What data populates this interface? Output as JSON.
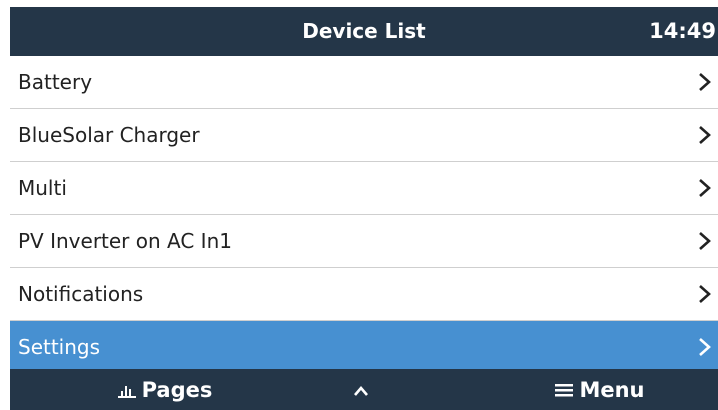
{
  "header": {
    "title": "Device List",
    "time": "14:49"
  },
  "list": {
    "items": [
      {
        "label": "Battery",
        "icon": "chevron-right-icon"
      },
      {
        "label": "BlueSolar Charger",
        "icon": "chevron-right-icon"
      },
      {
        "label": "Multi",
        "icon": "chevron-right-icon"
      },
      {
        "label": "PV Inverter on AC In1",
        "icon": "chevron-right-icon"
      },
      {
        "label": "Notifications",
        "icon": "chevron-right-icon"
      },
      {
        "label": "Settings",
        "icon": "chevron-right-icon",
        "selected": true
      }
    ]
  },
  "footer": {
    "pages_label": "Pages",
    "pages_icon": "bar-chart-icon",
    "up_icon": "chevron-up-icon",
    "menu_label": "Menu",
    "menu_icon": "hamburger-menu-icon"
  },
  "colors": {
    "bar_background": "#243648",
    "selected_background": "#4790d1",
    "divider": "#cfcfcf"
  }
}
